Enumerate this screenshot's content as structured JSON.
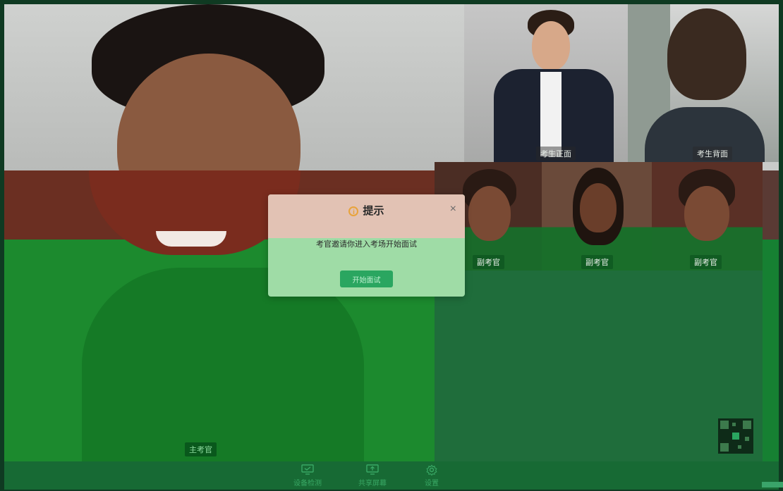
{
  "modal": {
    "title": "提示",
    "message": "考官邀请你进入考场开始面试",
    "button_label": "开始面试",
    "close_symbol": "×",
    "info_symbol": "i"
  },
  "video_tiles": {
    "main_label": "主考官",
    "candidate_front_label": "考生正面",
    "candidate_back_label": "考生背面",
    "small": [
      {
        "label": "副考官"
      },
      {
        "label": "副考官"
      },
      {
        "label": "副考官"
      }
    ]
  },
  "toolbar": {
    "items": [
      {
        "label": "设备检测",
        "icon": "monitor-check-icon"
      },
      {
        "label": "共享屏幕",
        "icon": "screen-share-icon"
      },
      {
        "label": "设置",
        "icon": "gear-icon"
      }
    ]
  },
  "colors": {
    "accent_green": "#2aa660",
    "info_orange": "#e8a33b"
  }
}
